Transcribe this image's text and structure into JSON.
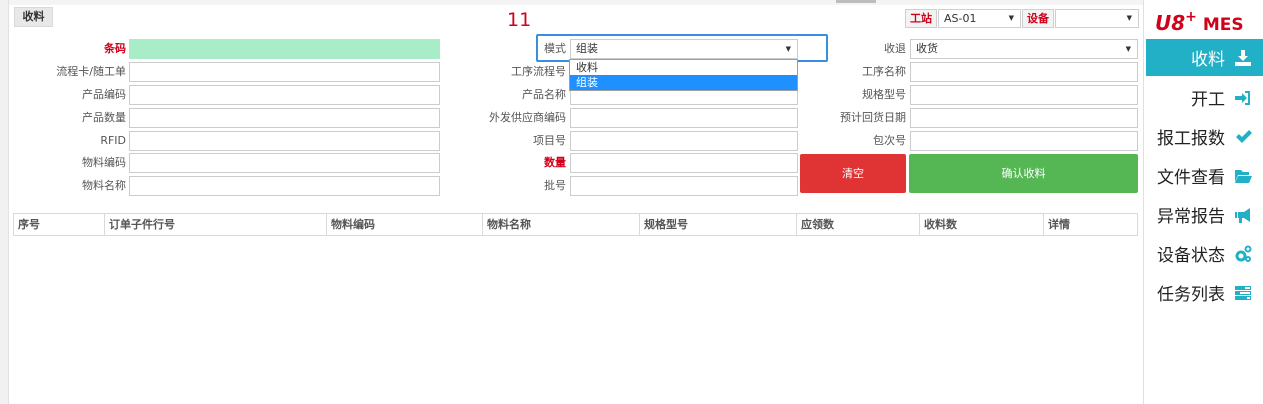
{
  "page_tab": "收料",
  "annotation": "11",
  "header": {
    "workstation_label": "工站",
    "workstation_value": "AS-01",
    "device_label": "设备",
    "device_value": ""
  },
  "form": {
    "barcode_label": "条码",
    "flowcard_label": "流程卡/随工单",
    "product_code_label": "产品编码",
    "product_qty_label": "产品数量",
    "rfid_label": "RFID",
    "material_code_label": "物料编码",
    "material_name_label": "物料名称",
    "mode_label": "模式",
    "mode_value": "组装",
    "process_flow_label": "工序流程号",
    "product_name_label": "产品名称",
    "supplier_code_label": "外发供应商编码",
    "project_no_label": "项目号",
    "quantity_label": "数量",
    "batch_label": "批号",
    "receive_return_label": "收退",
    "receive_return_value": "收货",
    "process_name_label": "工序名称",
    "spec_label": "规格型号",
    "expected_return_label": "预计回货日期",
    "package_no_label": "包次号"
  },
  "mode_options": [
    "收料",
    "组装"
  ],
  "mode_selected_index": 1,
  "buttons": {
    "clear": "清空",
    "confirm": "确认收料"
  },
  "table": {
    "columns": [
      "序号",
      "订单子件行号",
      "物料编码",
      "物料名称",
      "规格型号",
      "应领数",
      "收料数",
      "详情"
    ],
    "rows": []
  },
  "sidebar": {
    "logo_u8": "U8",
    "logo_plus": "+",
    "logo_mes": "MES",
    "items": [
      {
        "label": "收料",
        "icon": "download-icon",
        "active": true
      },
      {
        "label": "开工",
        "icon": "sign-in-icon",
        "active": false
      },
      {
        "label": "报工报数",
        "icon": "check-icon",
        "active": false
      },
      {
        "label": "文件查看",
        "icon": "folder-open-icon",
        "active": false
      },
      {
        "label": "异常报告",
        "icon": "bullhorn-icon",
        "active": false
      },
      {
        "label": "设备状态",
        "icon": "gears-icon",
        "active": false
      },
      {
        "label": "任务列表",
        "icon": "tasks-icon",
        "active": false
      }
    ],
    "icon_color": "#22b0c7",
    "active_color": "#22b0c7"
  },
  "colors": {
    "required_label": "#d0021b",
    "barcode_fill": "#a8ecc8",
    "clear_button": "#e03333",
    "confirm_button": "#55b754",
    "dropdown_highlight": "#1e90ff"
  }
}
